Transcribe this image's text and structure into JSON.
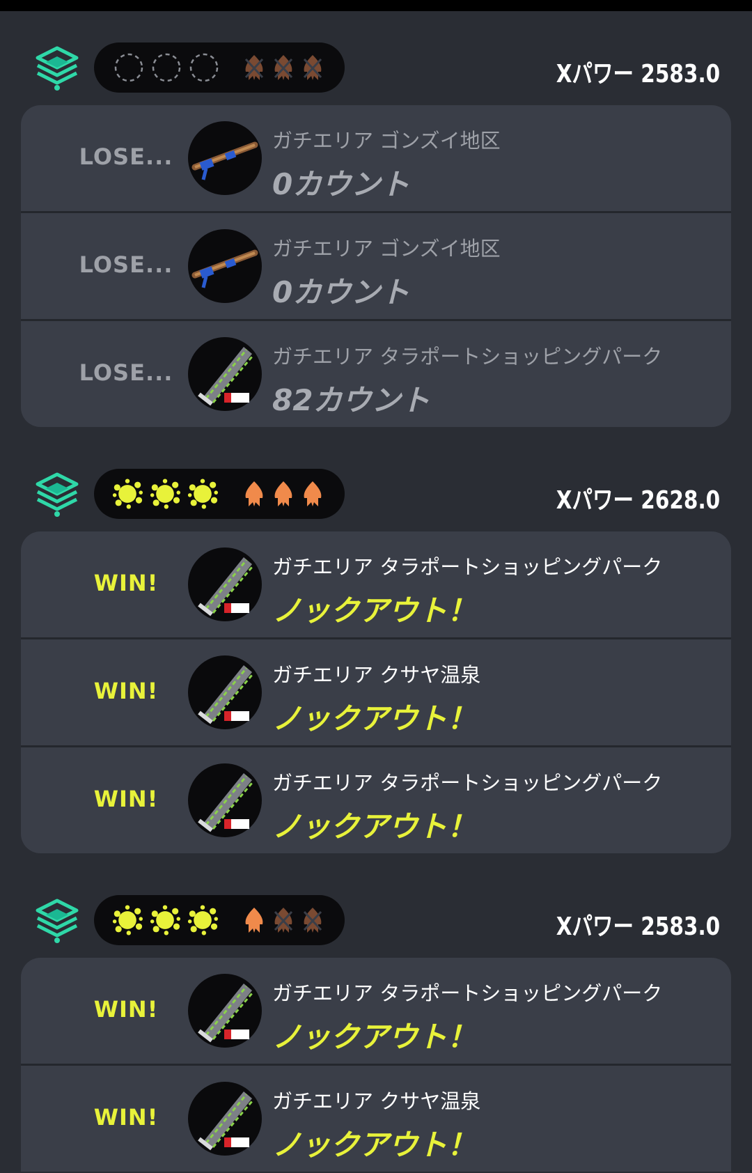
{
  "colors": {
    "background": "#2a2d34",
    "card": "#3a3e48",
    "win": "#e8f23a",
    "lose": "#9ea1a8",
    "ko_squid": "#f08a4b",
    "lost_squid": "#7a4a32",
    "mode_icon": "#2fd8a8"
  },
  "sets": [
    {
      "mode_icon": "splat-zones-icon",
      "game_marks": [
        "empty",
        "empty",
        "empty"
      ],
      "squid_marks": [
        "lost",
        "lost",
        "lost"
      ],
      "xpower": "Xパワー 2583.0",
      "games": [
        {
          "result": "LOSE...",
          "outcome": "lose",
          "weapon": "squiffer-icon",
          "stage": "ガチエリア ゴンズイ地区",
          "score": "0カウント"
        },
        {
          "result": "LOSE...",
          "outcome": "lose",
          "weapon": "squiffer-icon",
          "stage": "ガチエリア ゴンズイ地区",
          "score": "0カウント"
        },
        {
          "result": "LOSE...",
          "outcome": "lose",
          "weapon": "splatana-icon",
          "stage": "ガチエリア タラポートショッピングパーク",
          "score": "82カウント"
        }
      ]
    },
    {
      "mode_icon": "splat-zones-icon",
      "game_marks": [
        "win",
        "win",
        "win"
      ],
      "squid_marks": [
        "ko",
        "ko",
        "ko"
      ],
      "xpower": "Xパワー 2628.0",
      "games": [
        {
          "result": "WIN!",
          "outcome": "win",
          "weapon": "splatana-icon",
          "stage": "ガチエリア タラポートショッピングパーク",
          "score": "ノックアウト！"
        },
        {
          "result": "WIN!",
          "outcome": "win",
          "weapon": "splatana-icon",
          "stage": "ガチエリア クサヤ温泉",
          "score": "ノックアウト！"
        },
        {
          "result": "WIN!",
          "outcome": "win",
          "weapon": "splatana-icon",
          "stage": "ガチエリア タラポートショッピングパーク",
          "score": "ノックアウト！"
        }
      ]
    },
    {
      "mode_icon": "splat-zones-icon",
      "game_marks": [
        "win",
        "win",
        "win"
      ],
      "squid_marks": [
        "ko",
        "lost",
        "lost"
      ],
      "xpower": "Xパワー 2583.0",
      "games": [
        {
          "result": "WIN!",
          "outcome": "win",
          "weapon": "splatana-icon",
          "stage": "ガチエリア タラポートショッピングパーク",
          "score": "ノックアウト！"
        },
        {
          "result": "WIN!",
          "outcome": "win",
          "weapon": "splatana-icon",
          "stage": "ガチエリア クサヤ温泉",
          "score": "ノックアウト！"
        }
      ]
    }
  ]
}
